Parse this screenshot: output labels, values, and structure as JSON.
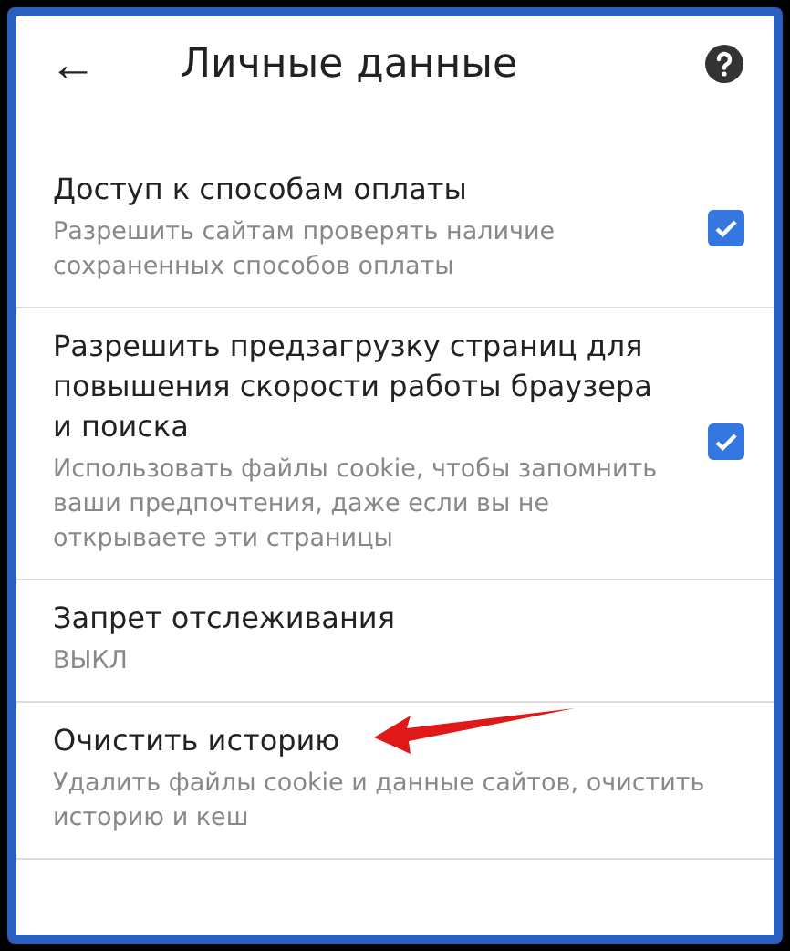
{
  "header": {
    "back": "←",
    "title": "Личные данные"
  },
  "items": [
    {
      "kind": "checkbox",
      "title": "Доступ к способам оплаты",
      "description": "Разрешить сайтам проверять наличие сохраненных способов оплаты",
      "checked": true
    },
    {
      "kind": "checkbox",
      "title": "Разрешить предзагрузку страниц для повышения скорости работы браузера и поиска",
      "description": "Использовать файлы cookie, чтобы запомнить ваши предпочтения, даже если вы не открываете эти страницы",
      "checked": true
    },
    {
      "kind": "value",
      "title": "Запрет отслеживания",
      "description": "ВЫКЛ"
    },
    {
      "kind": "plain",
      "title": "Очистить историю",
      "description": "Удалить файлы cookie и данные сайтов, очистить историю и кеш",
      "annotated": true
    }
  ]
}
